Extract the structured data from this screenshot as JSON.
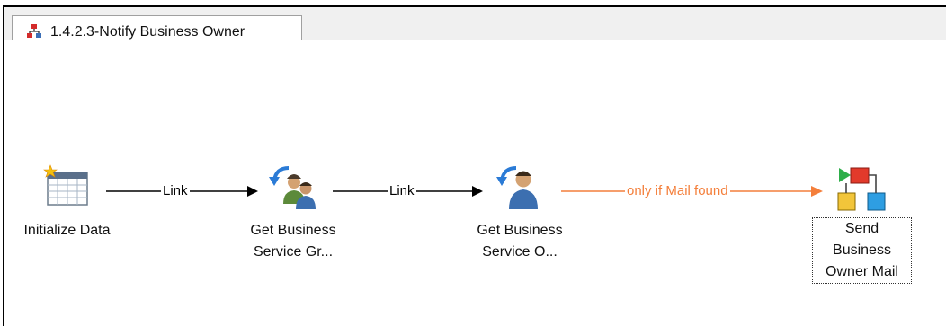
{
  "tab": {
    "title": "1.4.2.3-Notify Business Owner",
    "icon": "workflow-icon"
  },
  "workflow": {
    "nodes": [
      {
        "id": "initialize",
        "label": "Initialize Data",
        "icon": "table-sparkle-icon"
      },
      {
        "id": "get_group",
        "label_line1": "Get Business",
        "label_line2": "Service Gr...",
        "icon": "group-users-arrow-icon"
      },
      {
        "id": "get_owner",
        "label_line1": "Get Business",
        "label_line2": "Service O...",
        "icon": "user-arrow-icon"
      },
      {
        "id": "send_mail",
        "label_line1": "Send",
        "label_line2": "Business",
        "label_line3": "Owner Mail",
        "icon": "flow-blocks-icon"
      }
    ],
    "links": [
      {
        "label": "Link",
        "color": "#000000"
      },
      {
        "label": "Link",
        "color": "#000000"
      },
      {
        "label": "only if Mail found",
        "color": "#f47f3b"
      }
    ]
  }
}
